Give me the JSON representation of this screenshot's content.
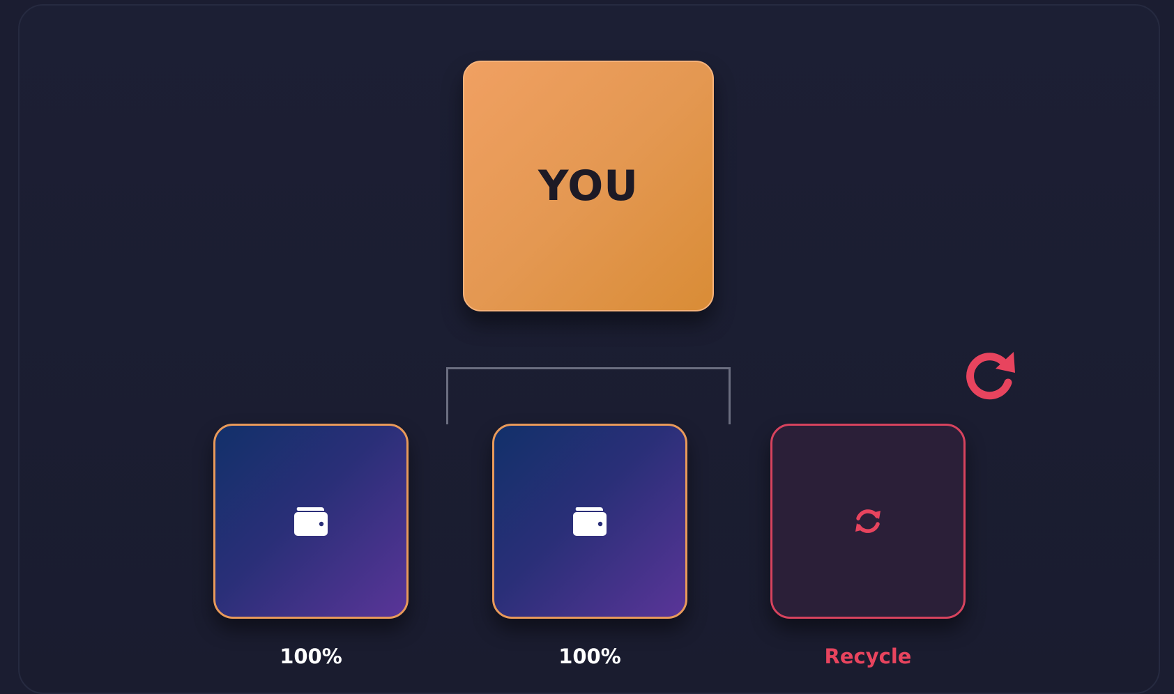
{
  "root": {
    "label": "YOU"
  },
  "children": [
    {
      "type": "wallet",
      "icon": "wallet-icon",
      "label": "100%"
    },
    {
      "type": "wallet",
      "icon": "wallet-icon",
      "label": "100%"
    },
    {
      "type": "recycle",
      "icon": "sync-icon",
      "label": "Recycle"
    }
  ],
  "actions": {
    "refresh_icon": "rotate-right-icon"
  },
  "colors": {
    "accent_orange": "#e49852",
    "accent_red": "#e8445e",
    "background": "#1b1d31",
    "wallet_gradient_start": "#12306a",
    "wallet_gradient_end": "#5a3598"
  }
}
